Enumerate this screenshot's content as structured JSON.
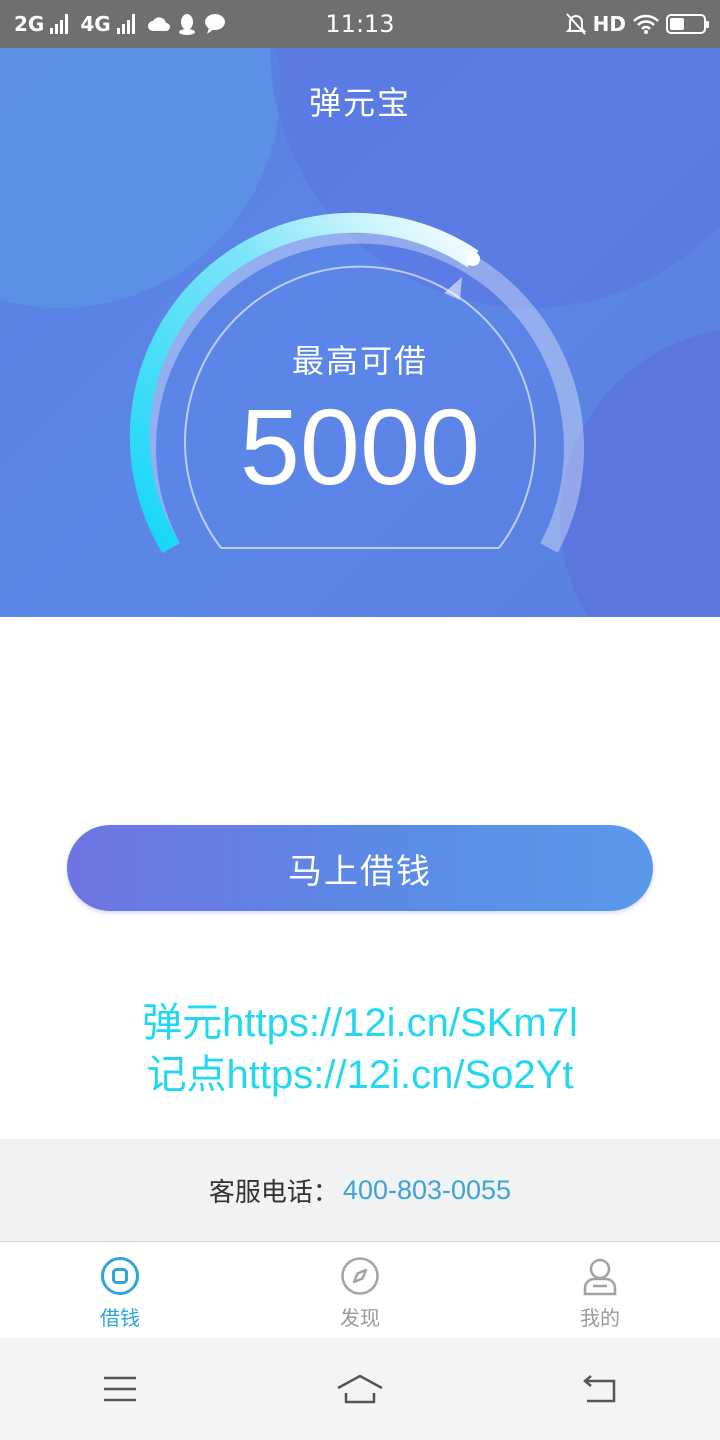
{
  "status_bar": {
    "network1": "2G",
    "network2": "4G",
    "time": "11:13",
    "hd": "HD",
    "battery_level": 0.45
  },
  "header": {
    "title": "弹元宝"
  },
  "gauge": {
    "label": "最高可借",
    "amount": "5000"
  },
  "borrow_button": {
    "label": "马上借钱"
  },
  "promo": {
    "line1": "弹元https://12i.cn/SKm7l",
    "line2": "记点https://12i.cn/So2Yt"
  },
  "service": {
    "label": "客服电话：",
    "phone": "400-803-0055"
  },
  "tabs": [
    {
      "label": "借钱",
      "icon": "borrow-icon",
      "active": true
    },
    {
      "label": "发现",
      "icon": "compass-icon",
      "active": false
    },
    {
      "label": "我的",
      "icon": "user-icon",
      "active": false
    }
  ],
  "colors": {
    "accent": "#2ea6d9",
    "promo": "#22d8f0",
    "hero": "#5b86e8"
  }
}
